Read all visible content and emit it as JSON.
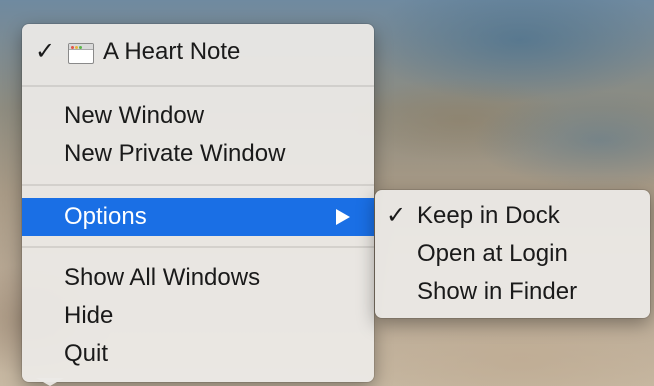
{
  "dock_menu": {
    "window_item": {
      "checked_mark": "✓",
      "label": "A Heart Note",
      "icon": "window-icon"
    },
    "new_window": "New Window",
    "new_private_window": "New Private Window",
    "options": {
      "label": "Options",
      "arrow_icon": "submenu-arrow-icon"
    },
    "show_all_windows": "Show All Windows",
    "hide": "Hide",
    "quit": "Quit",
    "highlight_color": "#1a6fe5"
  },
  "options_submenu": {
    "keep_in_dock": {
      "checked_mark": "✓",
      "label": "Keep in Dock"
    },
    "open_at_login": "Open at Login",
    "show_in_finder": "Show in Finder"
  }
}
